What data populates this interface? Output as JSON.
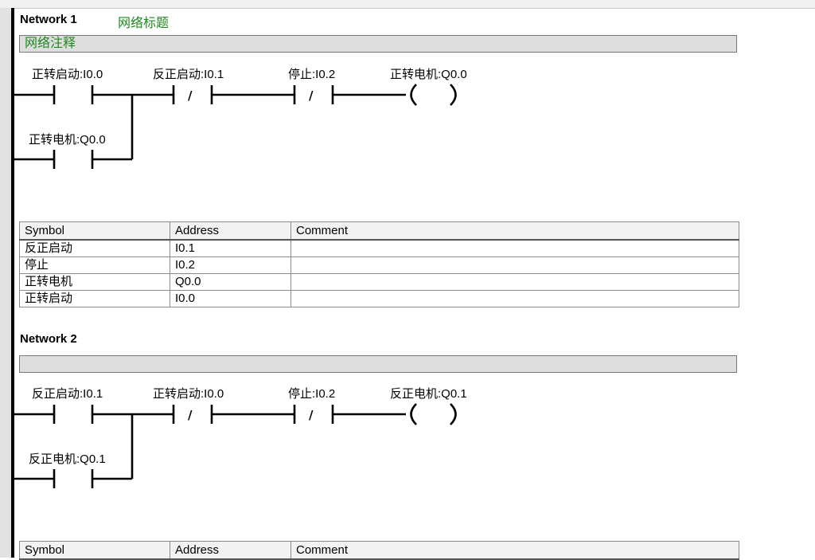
{
  "networks": [
    {
      "title": "Network 1",
      "subtitle": "网络标题",
      "comment": "网络注释",
      "contacts": [
        {
          "label": "正转启动:I0.0",
          "type": "NO"
        },
        {
          "label": "反正启动:I0.1",
          "type": "NC"
        },
        {
          "label": "停止:I0.2",
          "type": "NC"
        },
        {
          "label": "正转电机:Q0.0",
          "type": "NO-branch"
        }
      ],
      "coil": {
        "label": "正转电机:Q0.0"
      },
      "symbols": {
        "headers": [
          "Symbol",
          "Address",
          "Comment"
        ],
        "rows": [
          {
            "symbol": "反正启动",
            "address": "I0.1",
            "comment": ""
          },
          {
            "symbol": "停止",
            "address": "I0.2",
            "comment": ""
          },
          {
            "symbol": "正转电机",
            "address": "Q0.0",
            "comment": ""
          },
          {
            "symbol": "正转启动",
            "address": "I0.0",
            "comment": ""
          }
        ]
      }
    },
    {
      "title": "Network 2",
      "subtitle": "",
      "comment": "",
      "contacts": [
        {
          "label": "反正启动:I0.1",
          "type": "NO"
        },
        {
          "label": "正转启动:I0.0",
          "type": "NC"
        },
        {
          "label": "停止:I0.2",
          "type": "NC"
        },
        {
          "label": "反正电机:Q0.1",
          "type": "NO-branch"
        }
      ],
      "coil": {
        "label": "反正电机:Q0.1"
      },
      "symbols": {
        "headers": [
          "Symbol",
          "Address",
          "Comment"
        ],
        "rows": []
      }
    }
  ],
  "glyphs": {
    "nc_slash": "/"
  }
}
